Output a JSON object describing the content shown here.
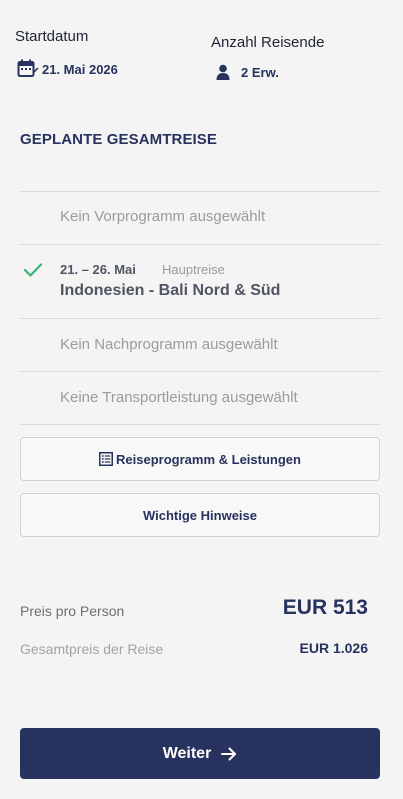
{
  "start": {
    "label": "Startdatum",
    "value": "21. Mai 2026",
    "icon": "calendar-icon"
  },
  "travelers": {
    "label": "Anzahl Reisende",
    "value": "2 Erw.",
    "icon": "person-icon"
  },
  "section_title": "GEPLANTE GESAMTREISE",
  "program": {
    "pre": "Kein Vorprogramm ausgewählt",
    "main": {
      "dates": "21. – 26. Mai",
      "tag": "Hauptreise",
      "title": "Indonesien - Bali Nord & Süd"
    },
    "post": "Kein Nachprogramm ausgewählt",
    "transport": "Keine Transportleistung ausgewählt"
  },
  "buttons": {
    "program_services": "Reiseprogramm & Leistungen",
    "notes": "Wichtige Hinweise",
    "next": "Weiter"
  },
  "pricing": {
    "per_person_label": "Preis pro Person",
    "per_person_value": "EUR 513",
    "total_label": "Gesamtpreis der Reise",
    "total_value": "EUR 1.026"
  },
  "colors": {
    "primary": "#27325e",
    "check": "#3cb371",
    "muted": "#9b9b9b",
    "background": "#f4f4f4"
  }
}
